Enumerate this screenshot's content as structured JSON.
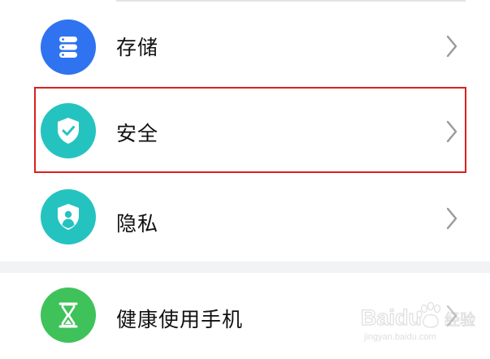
{
  "settings": {
    "items": [
      {
        "id": "storage",
        "label": "存储",
        "icon": "storage-icon",
        "color": "#2f73f0"
      },
      {
        "id": "security",
        "label": "安全",
        "icon": "shield-check-icon",
        "color": "#25c3c0"
      },
      {
        "id": "privacy",
        "label": "隐私",
        "icon": "privacy-shield-icon",
        "color": "#25c3c0"
      },
      {
        "id": "digital-balance",
        "label": "健康使用手机",
        "icon": "hourglass-icon",
        "color": "#3fc25a"
      }
    ]
  },
  "watermark": {
    "brand_text": "Baidu",
    "sub_text": "jingyan.baidu.com",
    "suffix_text": "经验"
  },
  "colors": {
    "highlight": "#d9201f",
    "section_gap": "#f1f3f5"
  }
}
